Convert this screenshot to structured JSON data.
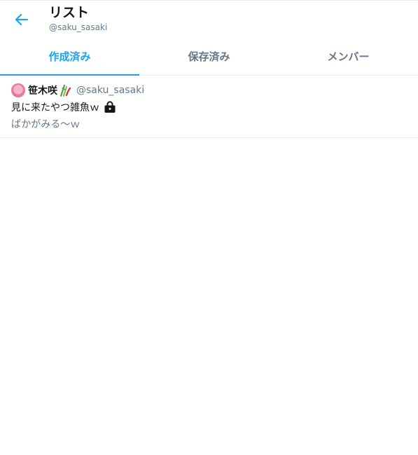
{
  "header": {
    "title": "リスト",
    "subtitle": "@saku_sasaki",
    "back_icon": "arrow-left-icon"
  },
  "tabs": [
    {
      "label": "作成済み",
      "active": true
    },
    {
      "label": "保存済み",
      "active": false
    },
    {
      "label": "メンバー",
      "active": false
    }
  ],
  "lists": [
    {
      "owner_name": "笹木咲",
      "owner_handle": "@saku_sasaki",
      "name": "見に来たやつ雑魚ｗ",
      "private": true,
      "description": "ばかがみる～ｗ"
    }
  ],
  "colors": {
    "accent": "#1da1f2",
    "text": "#14171a",
    "muted": "#657786",
    "border": "#e6ecf0"
  }
}
